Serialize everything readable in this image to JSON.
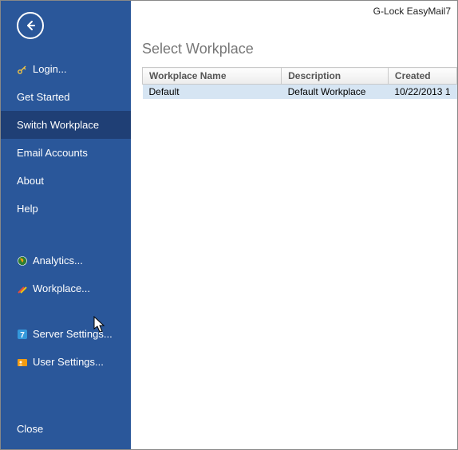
{
  "app_title": "G-Lock EasyMail7",
  "sidebar": {
    "items": [
      {
        "label": "Login...",
        "icon": "key"
      },
      {
        "label": "Get Started",
        "icon": ""
      },
      {
        "label": "Switch  Workplace",
        "icon": "",
        "active": true
      },
      {
        "label": "Email Accounts",
        "icon": ""
      },
      {
        "label": "About",
        "icon": ""
      },
      {
        "label": "Help",
        "icon": ""
      }
    ],
    "secondary": [
      {
        "label": "Analytics...",
        "icon": "globe"
      },
      {
        "label": "Workplace...",
        "icon": "tools"
      },
      {
        "label": "Server Settings...",
        "icon": "seven"
      },
      {
        "label": "User Settings...",
        "icon": "user"
      }
    ],
    "close": "Close"
  },
  "main": {
    "heading": "Select Workplace",
    "columns": [
      "Workplace Name",
      "Description",
      "Created"
    ],
    "rows": [
      {
        "name": "Default",
        "description": "Default Workplace",
        "created": "10/22/2013 1"
      }
    ]
  }
}
